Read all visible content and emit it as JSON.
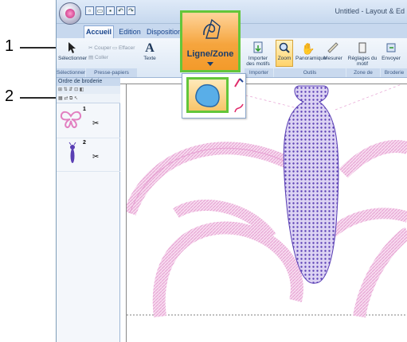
{
  "callouts": {
    "one": "1",
    "two": "2"
  },
  "window": {
    "title": "Untitled - Layout & Ed"
  },
  "qat_icons": [
    "new-icon",
    "open-icon",
    "save-icon",
    "undo-icon",
    "redo-icon"
  ],
  "tabs": [
    {
      "label": "Accueil"
    },
    {
      "label": "Edition"
    },
    {
      "label": "Disposition"
    }
  ],
  "ribbon": {
    "select_label": "Sélectionner",
    "cut_label": "Couper",
    "erase_label": "Effacer",
    "paste_label": "Coller",
    "text_label": "Texte",
    "import_label": "Importer des motifs",
    "zoom_label": "Zoom",
    "pan_label": "Panoramique",
    "measure_label": "Mesurer",
    "settings_label": "Réglages du motif",
    "send_label": "Envoyer",
    "groups": {
      "select": "Sélectionner",
      "clipboard": "Presse-papiers",
      "import": "Importer",
      "tools": "Outils",
      "creation": "Zone de création",
      "embroidery": "Broderie"
    }
  },
  "big_button": {
    "label": "Ligne/Zone"
  },
  "panel": {
    "title": "Ordre de broderie"
  },
  "sequence": [
    {
      "num": "1"
    },
    {
      "num": "2"
    }
  ],
  "colors": {
    "highlight_green": "#63c63a",
    "pink_stitch": "#e6a0d2",
    "purple_stitch": "#5a3fb4",
    "ribbon_blue": "#dbe7f5"
  }
}
